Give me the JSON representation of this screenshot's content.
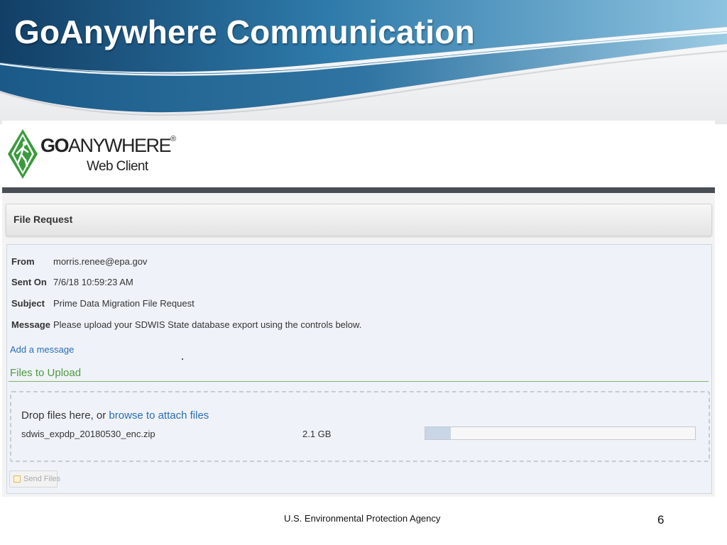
{
  "slide": {
    "title": "GoAnywhere Communication",
    "footer_agency": "U.S. Environmental Protection Agency",
    "page_number": "6"
  },
  "colors": {
    "banner_dark": "#123f66",
    "banner_mid": "#2e7aaa",
    "banner_light": "#8ec3e0",
    "link": "#2a6db8",
    "section_green": "#4e9a3a",
    "logo_green": "#3a9b3c"
  },
  "app": {
    "logo_bold": "GO",
    "logo_rest": "ANYWHERE",
    "logo_reg": "®",
    "logo_sub": "Web Client",
    "logo_icon": "hiker-badge-icon"
  },
  "panel": {
    "title": "File Request"
  },
  "request": {
    "fields": [
      {
        "label": "From",
        "value": "morris.renee@epa.gov"
      },
      {
        "label": "Sent On",
        "value": "7/6/18 10:59:23 AM"
      },
      {
        "label": "Subject",
        "value": "Prime Data Migration File Request"
      },
      {
        "label": "Message",
        "value": "Please upload your SDWIS State database export using the controls below."
      }
    ],
    "add_message": "Add a message"
  },
  "files": {
    "heading": "Files to Upload",
    "drop_text": "Drop files here, or ",
    "browse_link": "browse to attach files",
    "items": [
      {
        "name": "sdwis_expdp_20180530_enc.zip",
        "size": "2.1 GB",
        "progress": 0.095
      }
    ]
  },
  "actions": {
    "send_label": "Send Files",
    "send_icon": "checkbox-icon"
  }
}
